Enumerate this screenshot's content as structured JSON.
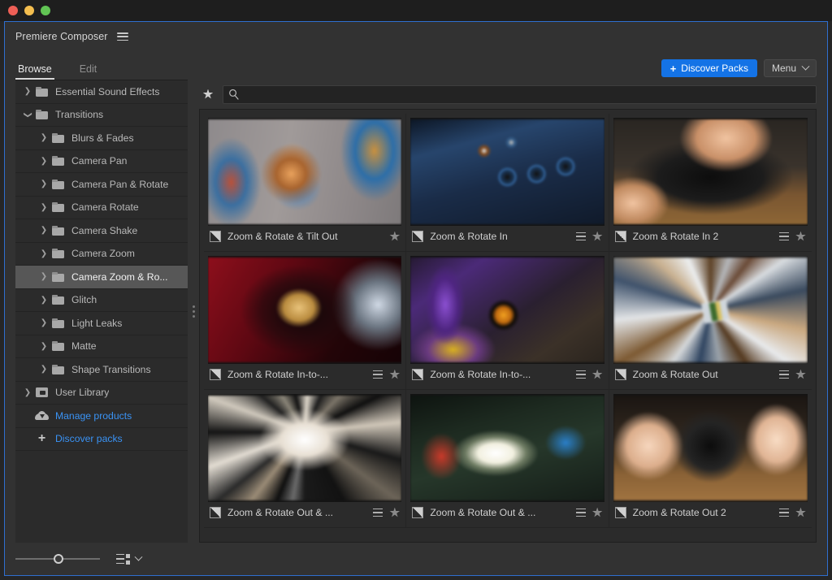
{
  "window": {
    "traffic_lights": [
      "close",
      "minimize",
      "zoom"
    ]
  },
  "plugin": {
    "title": "Premiere Composer",
    "menu_icon": "hamburger-icon"
  },
  "tabs": [
    {
      "label": "Browse",
      "active": true
    },
    {
      "label": "Edit",
      "active": false
    }
  ],
  "header_actions": {
    "discover_packs_label": "Discover Packs",
    "discover_packs_plus": "+",
    "discover_packs_color": "#1473e6",
    "menu_label": "Menu"
  },
  "search": {
    "value": "",
    "placeholder": "",
    "favorites_icon": "star-icon",
    "search_icon": "magnifier-icon"
  },
  "sidebar": {
    "items": [
      {
        "label": "Essential Sound Effects",
        "depth": 0,
        "icon": "folder-icon",
        "expanded": false,
        "selected": false,
        "arrow": "collapsed"
      },
      {
        "label": "Transitions",
        "depth": 0,
        "icon": "folder-icon",
        "expanded": true,
        "selected": false,
        "arrow": "expanded"
      },
      {
        "label": "Blurs & Fades",
        "depth": 1,
        "icon": "folder-icon",
        "expanded": false,
        "selected": false,
        "arrow": "collapsed"
      },
      {
        "label": "Camera Pan",
        "depth": 1,
        "icon": "folder-icon",
        "expanded": false,
        "selected": false,
        "arrow": "collapsed"
      },
      {
        "label": "Camera Pan & Rotate",
        "depth": 1,
        "icon": "folder-icon",
        "expanded": false,
        "selected": false,
        "arrow": "collapsed"
      },
      {
        "label": "Camera Rotate",
        "depth": 1,
        "icon": "folder-icon",
        "expanded": false,
        "selected": false,
        "arrow": "collapsed"
      },
      {
        "label": "Camera Shake",
        "depth": 1,
        "icon": "folder-icon",
        "expanded": false,
        "selected": false,
        "arrow": "collapsed"
      },
      {
        "label": "Camera Zoom",
        "depth": 1,
        "icon": "folder-icon",
        "expanded": false,
        "selected": false,
        "arrow": "collapsed"
      },
      {
        "label": "Camera Zoom & Ro...",
        "depth": 1,
        "icon": "folder-icon",
        "expanded": false,
        "selected": true,
        "arrow": "collapsed"
      },
      {
        "label": "Glitch",
        "depth": 1,
        "icon": "folder-icon",
        "expanded": false,
        "selected": false,
        "arrow": "collapsed"
      },
      {
        "label": "Light Leaks",
        "depth": 1,
        "icon": "folder-icon",
        "expanded": false,
        "selected": false,
        "arrow": "collapsed"
      },
      {
        "label": "Matte",
        "depth": 1,
        "icon": "folder-icon",
        "expanded": false,
        "selected": false,
        "arrow": "collapsed"
      },
      {
        "label": "Shape Transitions",
        "depth": 1,
        "icon": "folder-icon",
        "expanded": false,
        "selected": false,
        "arrow": "collapsed"
      },
      {
        "label": "User Library",
        "depth": 0,
        "icon": "library-icon",
        "expanded": false,
        "selected": false,
        "arrow": "collapsed"
      },
      {
        "label": "Manage products",
        "depth": 0,
        "icon": "cloud-download-icon",
        "link": true,
        "arrow": "none"
      },
      {
        "label": "Discover packs",
        "depth": 0,
        "icon": "plus-icon",
        "link": true,
        "arrow": "none"
      }
    ],
    "link_color": "#3a93f5"
  },
  "grid": {
    "items": [
      {
        "label": "Zoom & Rotate & Tilt Out",
        "art": "art-a",
        "has_menu": false,
        "favorited": false
      },
      {
        "label": "Zoom & Rotate In",
        "art": "art-b",
        "has_menu": true,
        "favorited": false
      },
      {
        "label": "Zoom & Rotate In 2",
        "art": "art-c",
        "has_menu": true,
        "favorited": false
      },
      {
        "label": "Zoom & Rotate In-to-...",
        "art": "art-d",
        "has_menu": true,
        "favorited": false
      },
      {
        "label": "Zoom & Rotate In-to-...",
        "art": "art-e",
        "has_menu": true,
        "favorited": false
      },
      {
        "label": "Zoom & Rotate Out",
        "art": "art-f",
        "has_menu": true,
        "favorited": false
      },
      {
        "label": "Zoom & Rotate Out & ...",
        "art": "art-g",
        "has_menu": true,
        "favorited": false
      },
      {
        "label": "Zoom & Rotate Out & ...",
        "art": "art-h",
        "has_menu": true,
        "favorited": false
      },
      {
        "label": "Zoom & Rotate Out 2",
        "art": "art-i",
        "has_menu": true,
        "favorited": false
      }
    ]
  },
  "footer": {
    "zoom_slider_value": 45,
    "view_mode_icon": "list-view-icon",
    "view_mode_chevron": "chevron-down-icon"
  }
}
